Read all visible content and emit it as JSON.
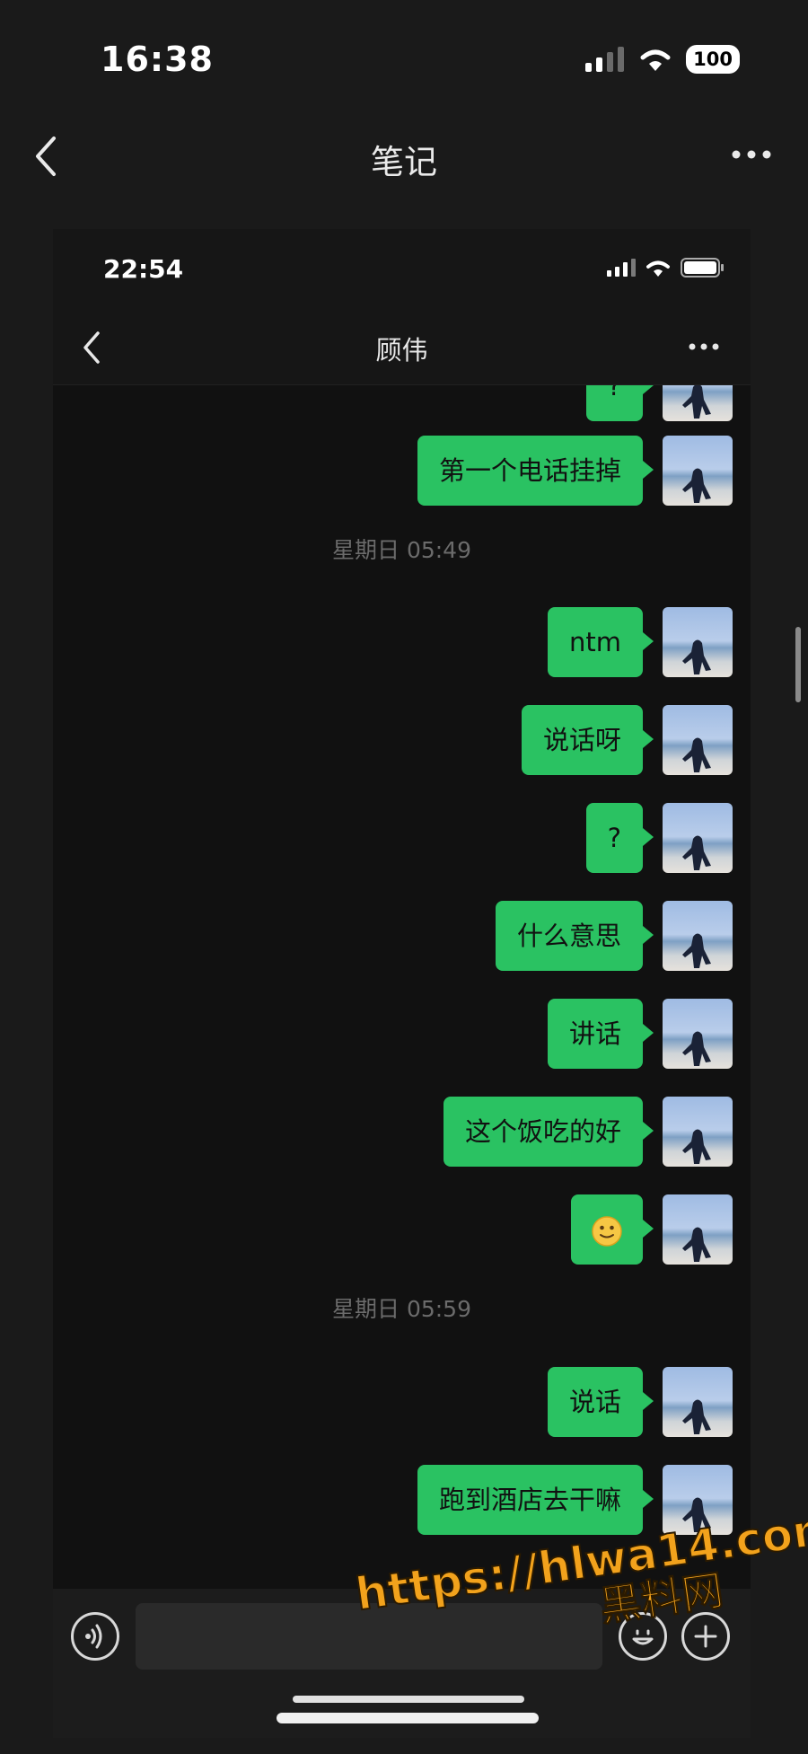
{
  "status_bar": {
    "time": "16:38",
    "battery": "100"
  },
  "outer_nav": {
    "title": "笔记"
  },
  "embedded": {
    "status_time": "22:54",
    "contact_name": "顾伟",
    "messages": [
      {
        "text": "?"
      },
      {
        "text": "第一个电话挂掉"
      },
      {
        "timestamp": "星期日 05:49"
      },
      {
        "text": "ntm"
      },
      {
        "text": "说话呀"
      },
      {
        "text": "?"
      },
      {
        "text": "什么意思"
      },
      {
        "text": "讲话"
      },
      {
        "text": "这个饭吃的好"
      },
      {
        "emoji": "slightly-smiling-face-icon"
      },
      {
        "timestamp": "星期日 05:59"
      },
      {
        "text": "说话"
      },
      {
        "text": "跑到酒店去干嘛"
      }
    ]
  },
  "watermark": {
    "url": "https://hlwa14.com",
    "name": "黑料网"
  },
  "colors": {
    "bubble": "#2ac262",
    "background": "#111111",
    "accent": "#f2a21c"
  }
}
